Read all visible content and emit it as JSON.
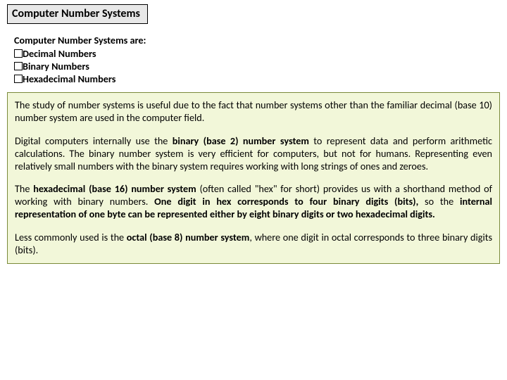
{
  "title": "Computer Number Systems",
  "intro": {
    "heading": "Computer Number Systems are:",
    "items": [
      "Decimal Numbers",
      "Binary Numbers",
      "Hexadecimal Numbers"
    ]
  },
  "paragraphs": {
    "p1_a": "The study of number systems is useful due to the fact that number systems other than the familiar decimal (base 10) number system are used in the computer field.",
    "p2_a": "Digital computers internally use the ",
    "p2_b": "binary (base 2) number system",
    "p2_c": " to represent data and perform arithmetic calculations. The binary number system is very efficient for computers, but not for humans. Representing even relatively small numbers with the binary system requires working with long strings of ones and zeroes.",
    "p3_a": "The ",
    "p3_b": "hexadecimal (base 16) number system",
    "p3_c": " (often called \"hex\" for short) provides us with a shorthand method of working with binary numbers. ",
    "p3_d": "One digit in hex corresponds to four binary digits (bits),",
    "p3_e": " so the ",
    "p3_f": "internal representation of one byte can be represented either by eight binary digits or two hexadecimal digits.",
    "p4_a": "Less commonly used is the ",
    "p4_b": "octal (base 8) number system",
    "p4_c": ", where one digit in octal corresponds to three binary digits (bits)."
  }
}
